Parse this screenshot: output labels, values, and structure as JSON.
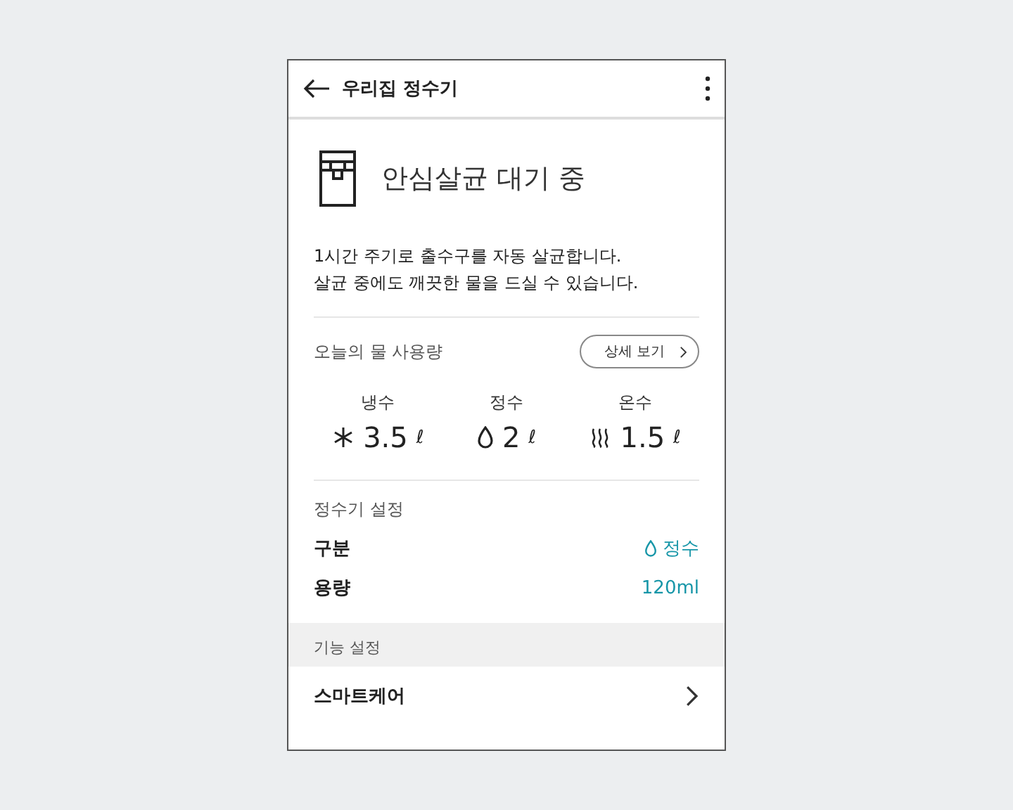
{
  "header": {
    "title": "우리집 정수기"
  },
  "status": {
    "title": "안심살균 대기 중",
    "description": "1시간 주기로 출수구를 자동 살균합니다.\n살균 중에도 깨끗한 물을 드실 수 있습니다."
  },
  "usage": {
    "title": "오늘의 물 사용량",
    "detail_button": "상세 보기",
    "items": [
      {
        "kind": "cold",
        "label": "냉수",
        "amount": "3.5",
        "unit": "ℓ"
      },
      {
        "kind": "purified",
        "label": "정수",
        "amount": "2",
        "unit": "ℓ"
      },
      {
        "kind": "hot",
        "label": "온수",
        "amount": "1.5",
        "unit": "ℓ"
      }
    ]
  },
  "settings": {
    "title": "정수기 설정",
    "rows": [
      {
        "kind": "water",
        "label": "구분",
        "value": "정수"
      },
      {
        "kind": "text",
        "label": "용량",
        "value": "120ml"
      }
    ]
  },
  "features": {
    "title": "기능 설정",
    "items": [
      {
        "label": "스마트케어"
      }
    ]
  }
}
